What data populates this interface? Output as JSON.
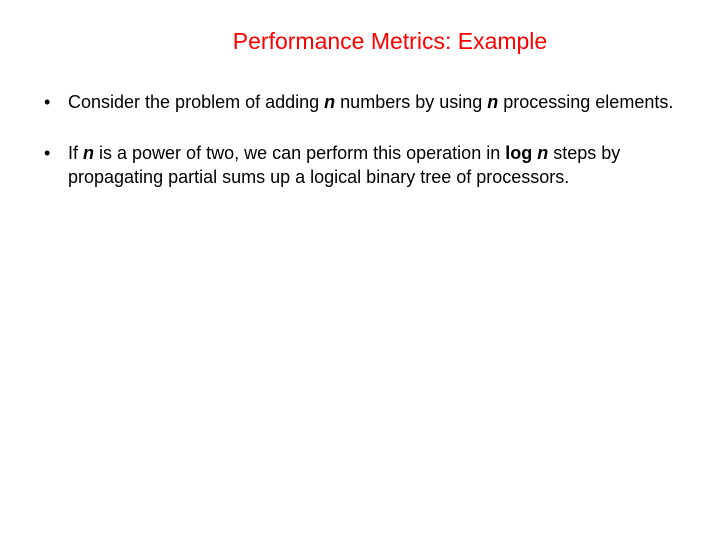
{
  "title": "Performance Metrics: Example",
  "bullets": [
    {
      "dot": "•",
      "segments": [
        {
          "text": "Consider the problem of adding ",
          "style": ""
        },
        {
          "text": "n",
          "style": "italic-bold"
        },
        {
          "text": " numbers by using ",
          "style": ""
        },
        {
          "text": "n",
          "style": "italic-bold"
        },
        {
          "text": " processing elements.",
          "style": ""
        }
      ]
    },
    {
      "dot": "•",
      "segments": [
        {
          "text": "If ",
          "style": ""
        },
        {
          "text": "n",
          "style": "italic-bold"
        },
        {
          "text": " is a power of two, we can perform this operation in ",
          "style": ""
        },
        {
          "text": "log ",
          "style": "bold"
        },
        {
          "text": "n",
          "style": "italic-bold"
        },
        {
          "text": " steps by propagating partial sums up a logical binary tree of processors.",
          "style": ""
        }
      ]
    }
  ]
}
